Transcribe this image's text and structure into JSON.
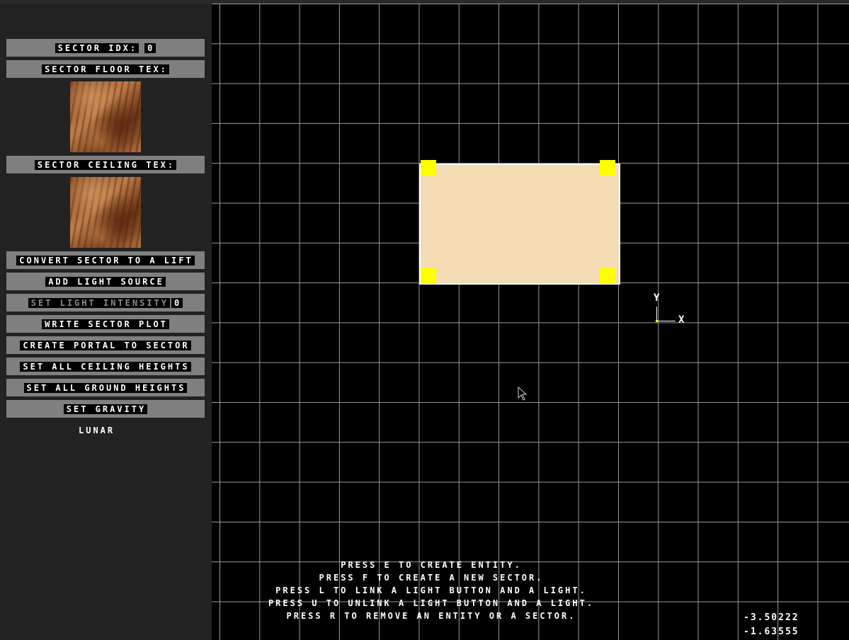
{
  "sidebar": {
    "sector_idx_label": "SECTOR IDX:",
    "sector_idx_value": "0",
    "floor_tex_label": "SECTOR FLOOR TEX:",
    "floor_texture": "rusty-metal-texture",
    "ceiling_tex_label": "SECTOR CEILING TEX:",
    "ceiling_texture": "rusty-metal-texture",
    "convert_lift": "CONVERT SECTOR TO A LIFT",
    "add_light": "ADD LIGHT SOURCE",
    "set_light_intensity": "SET LIGHT INTENSITY",
    "light_intensity_value": "0",
    "write_plot": "WRITE SECTOR PLOT",
    "create_portal": "CREATE PORTAL TO SECTOR",
    "set_ceiling_heights": "SET ALL CEILING HEIGHTS",
    "set_ground_heights": "SET ALL GROUND HEIGHTS",
    "set_gravity": "SET GRAVITY",
    "gravity_value": "LUNAR"
  },
  "canvas": {
    "axis_y_label": "Y",
    "axis_x_label": "X",
    "sector_fill_color": "#f3dcb4",
    "vertex_color": "#ffff00",
    "grid_color": "#9a9a9a"
  },
  "help": {
    "line1": "PRESS E TO CREATE ENTITY.",
    "line2": "PRESS F TO CREATE A NEW SECTOR.",
    "line3": "PRESS L TO LINK A LIGHT BUTTON AND A LIGHT.",
    "line4": "PRESS U TO UNLINK A LIGHT BUTTON AND A LIGHT.",
    "line5": "PRESS R TO REMOVE AN ENTITY OR A SECTOR."
  },
  "coords": {
    "x": "-3.50222",
    "y": "-1.63555"
  }
}
